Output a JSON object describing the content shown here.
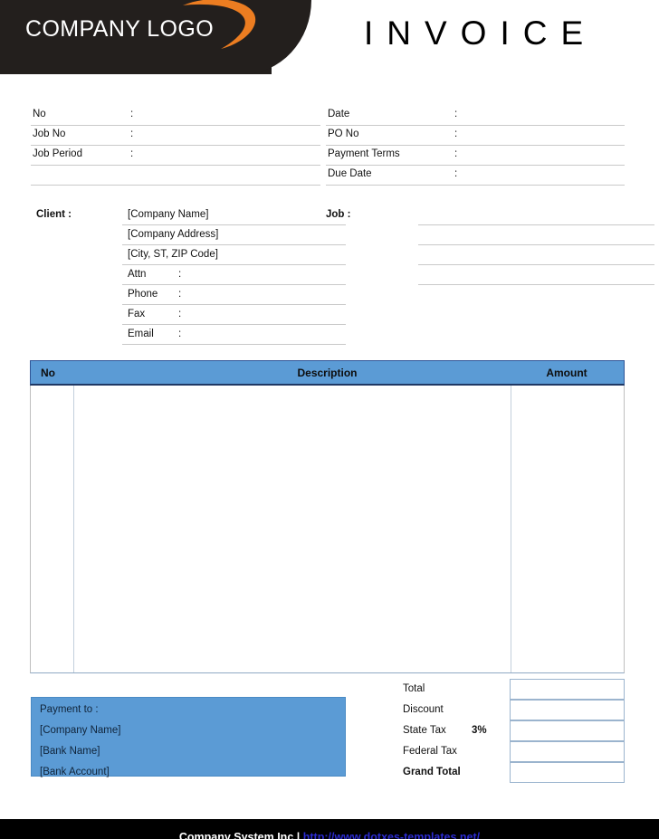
{
  "header": {
    "logo_text": "COMPANY LOGO",
    "logo_swoosh_icon": "orange-swoosh-icon",
    "title": "INVOICE",
    "band_color": "#231f1d",
    "swoosh_color": "#ec7d21"
  },
  "meta": {
    "rows": [
      {
        "left_label": "No",
        "left_colon": ":",
        "left_value": "",
        "right_label": "Date",
        "right_colon": ":",
        "right_value": ""
      },
      {
        "left_label": "Job No",
        "left_colon": ":",
        "left_value": "",
        "right_label": "PO No",
        "right_colon": ":",
        "right_value": ""
      },
      {
        "left_label": "Job Period",
        "left_colon": ":",
        "left_value": "",
        "right_label": "Payment  Terms",
        "right_colon": ":",
        "right_value": ""
      },
      {
        "left_label": "",
        "left_colon": "",
        "left_value": "",
        "right_label": "Due Date",
        "right_colon": ":",
        "right_value": ""
      }
    ]
  },
  "client": {
    "title": "Client  :",
    "lines": [
      {
        "placeholder": "[Company Name]",
        "label": "",
        "colon": "",
        "value": ""
      },
      {
        "placeholder": "[Company Address]",
        "label": "",
        "colon": "",
        "value": ""
      },
      {
        "placeholder": "[City, ST, ZIP Code]",
        "label": "",
        "colon": "",
        "value": ""
      },
      {
        "placeholder": "",
        "label": "Attn",
        "colon": ":",
        "value": ""
      },
      {
        "placeholder": "",
        "label": "Phone",
        "colon": ":",
        "value": ""
      },
      {
        "placeholder": "",
        "label": "Fax",
        "colon": ":",
        "value": ""
      },
      {
        "placeholder": "",
        "label": "Email",
        "colon": ":",
        "value": ""
      }
    ]
  },
  "job": {
    "title": "Job  :",
    "lines": [
      {
        "value": ""
      },
      {
        "value": ""
      },
      {
        "value": ""
      },
      {
        "value": ""
      }
    ]
  },
  "items_table": {
    "header_bg": "#5b9bd5",
    "columns": {
      "no": "No",
      "description": "Description",
      "amount": "Amount"
    },
    "rows": []
  },
  "payment": {
    "bg_color": "#5b9bd5",
    "heading": "Payment to :",
    "company_name": "[Company Name]",
    "bank_name": "[Bank Name]",
    "bank_account": "[Bank Account]"
  },
  "totals": {
    "rows": [
      {
        "label": "Total",
        "pct": "",
        "value": "",
        "bold": false
      },
      {
        "label": "Discount",
        "pct": "",
        "value": "",
        "bold": false
      },
      {
        "label": "State Tax",
        "pct": "3%",
        "value": "",
        "bold": false
      },
      {
        "label": "Federal Tax",
        "pct": "",
        "value": "",
        "bold": false
      },
      {
        "label": "Grand Total",
        "pct": "",
        "value": "",
        "bold": true
      }
    ]
  },
  "footer": {
    "company": "Company System Inc",
    "separator": "|",
    "link": "http://www.dotxes-templates.net/",
    "bg_color": "#000000",
    "link_color": "#2b2bd0"
  }
}
